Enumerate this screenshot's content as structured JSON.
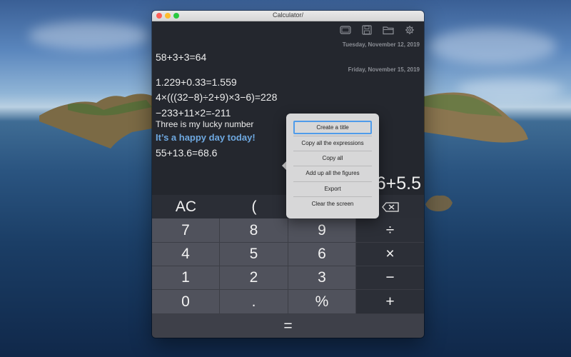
{
  "window": {
    "title": "Calculator/"
  },
  "toolbar": {
    "icons": [
      "screen-icon",
      "save-icon",
      "folder-icon",
      "settings-gear-icon"
    ]
  },
  "history": {
    "date1": "Tuesday, November 12, 2019",
    "entry1": "58+3+3=64",
    "date2": "Friday, November 15, 2019",
    "entry2": "1.229+0.33=1.559",
    "entry3": "4×(((32−8)÷2+9)×3−6)=228",
    "entry4": "−233+11×2=-211",
    "note1": "Three is my lucky number",
    "title1": "It’s a happy day today!",
    "entry5": "55+13.6=68.6"
  },
  "display": {
    "value": "6+5.5"
  },
  "context_menu": {
    "items": [
      "Create a title",
      "Copy all the expressions",
      "Copy all",
      "Add up all the figures",
      "Export",
      "Clear the screen"
    ],
    "selected_index": 0
  },
  "keypad": {
    "ac": "AC",
    "paren": "(",
    "k7": "7",
    "k8": "8",
    "k9": "9",
    "div": "÷",
    "k4": "4",
    "k5": "5",
    "k6": "6",
    "mul": "×",
    "k1": "1",
    "k2": "2",
    "k3": "3",
    "sub": "−",
    "k0": "0",
    "dot": ".",
    "pct": "%",
    "add": "+",
    "eq": "="
  },
  "colors": {
    "accent_title": "#6ea8e0",
    "menu_selection": "#4f9bea"
  }
}
